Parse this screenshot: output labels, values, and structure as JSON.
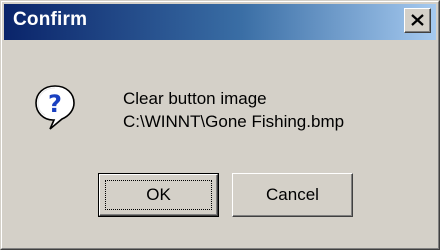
{
  "dialog": {
    "title": "Confirm",
    "icon": "question-icon",
    "message_line1": "Clear button image",
    "message_line2": "C:\\WINNT\\Gone Fishing.bmp"
  },
  "buttons": {
    "ok_label": "OK",
    "cancel_label": "Cancel"
  },
  "colors": {
    "face": "#d4d0c8",
    "title_start": "#0a246a",
    "title_end": "#a6caf0",
    "title_text": "#ffffff",
    "icon_blue": "#1a40c0"
  }
}
